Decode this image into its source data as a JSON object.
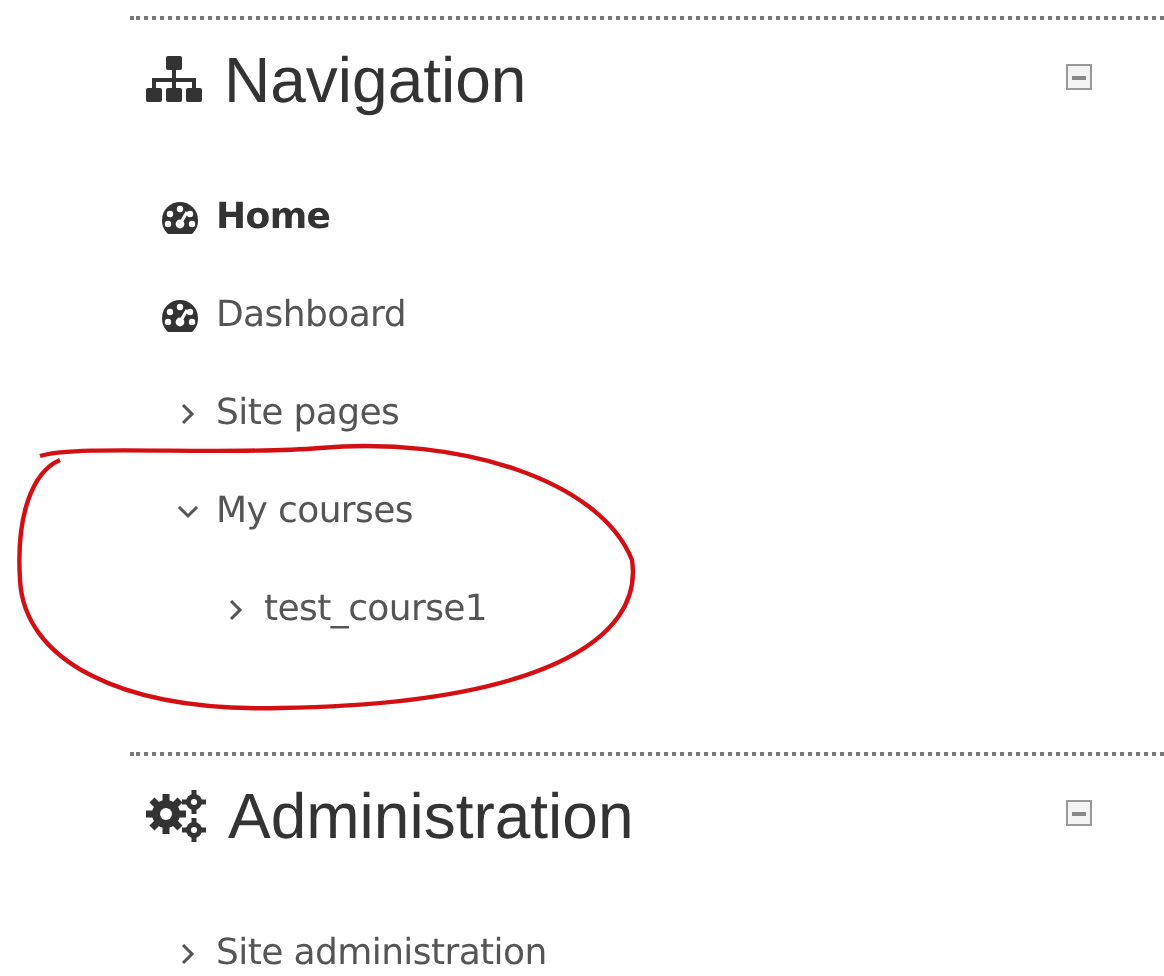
{
  "blocks": [
    {
      "kind": "navigation",
      "title": "Navigation",
      "collapsed": false,
      "items": [
        {
          "label": "Home",
          "kind": "link",
          "selected": true
        },
        {
          "label": "Dashboard",
          "kind": "link",
          "selected": false
        },
        {
          "label": "Site pages",
          "kind": "branch",
          "expanded": false
        },
        {
          "label": "My courses",
          "kind": "branch",
          "expanded": true,
          "children": [
            {
              "label": "test_course1",
              "kind": "branch",
              "expanded": false
            }
          ]
        }
      ]
    },
    {
      "kind": "administration",
      "title": "Administration",
      "collapsed": false,
      "items": [
        {
          "label": "Site administration",
          "kind": "branch",
          "expanded": false
        }
      ]
    }
  ]
}
